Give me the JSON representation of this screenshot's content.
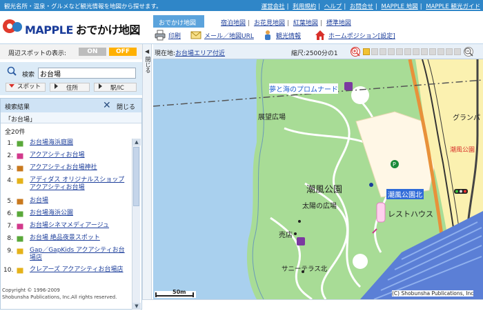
{
  "topbar": {
    "tagline": "観光名所・温泉・グルメなど観光情報を地図から探せます。",
    "links": [
      "運営会社",
      "利用規約",
      "ヘルプ",
      "お問合せ",
      "MAPPLE 地図",
      "MAPPLE 観光ガイド"
    ]
  },
  "logo": {
    "brand": "MAPPLE",
    "subtitle": "おでかけ地図"
  },
  "tabs": {
    "active": "おでかけ地図",
    "links": [
      "宿泊地図",
      "お花見地図",
      "紅葉地図",
      "標準地図"
    ]
  },
  "tools": {
    "print": "印刷",
    "mail": "メール／地図URL",
    "sightseeing": "観光情報",
    "home": "ホームポジション[設定]"
  },
  "nearby": {
    "label": "周辺スポットの表示:",
    "on": "ON",
    "off": "OFF"
  },
  "search": {
    "label": "検索",
    "value": "お台場",
    "buttons": [
      "スポット",
      "住所",
      "駅/IC"
    ]
  },
  "results": {
    "header": "検索結果",
    "close": "閉じる",
    "query": "「お台場」",
    "total": "全20件",
    "items": [
      {
        "num": "1.",
        "text": "お台場海浜庭園",
        "icon_color": "#5aa83a"
      },
      {
        "num": "2.",
        "text": "アクアシティお台場",
        "icon_color": "#d23a8c"
      },
      {
        "num": "3.",
        "text": "アクアシティお台場神社",
        "icon_color": "#c9791e"
      },
      {
        "num": "4.",
        "text": "アディダス オリジナルスショップ アクアシティお台場",
        "icon_color": "#e4b21a"
      },
      {
        "num": "5.",
        "text": "お台場",
        "icon_color": "#c9791e"
      },
      {
        "num": "6.",
        "text": "お台場海浜公園",
        "icon_color": "#5aa83a"
      },
      {
        "num": "7.",
        "text": "お台場シネマメディアージュ",
        "icon_color": "#d23a8c"
      },
      {
        "num": "8.",
        "text": "お台場 絶品夜景スポット",
        "icon_color": "#5aa83a"
      },
      {
        "num": "9.",
        "text": "Gap／GapKids アクアシティお台場店",
        "icon_color": "#e4b21a"
      },
      {
        "num": "10.",
        "text": "クレアーズ アクアシティお台場店",
        "icon_color": "#e4b21a"
      }
    ]
  },
  "copyright": {
    "line1": "Copyright © 1996-2009",
    "line2": "Shobunsha Publications, Inc.All rights reserved."
  },
  "collapse": {
    "label": "閉じる"
  },
  "mapbar": {
    "current_label": "現在地:",
    "current_value": "お台場エリア付近",
    "scale": "縮尺:2500分の1"
  },
  "map": {
    "labels": {
      "promenade": "夢と海のプロムナード",
      "observatory": "展望広場",
      "park": "潮風公園",
      "sun_square": "太陽の広場",
      "park_north": "潮風公園北",
      "rest_house": "レストハウス",
      "shop": "売店",
      "terrace": "サニーテラス北",
      "grand": "グランパ",
      "park_east": "潮風公園",
      "scale_bar": "50m",
      "credit": "(C) Shobunsha Publications, Inc"
    }
  }
}
